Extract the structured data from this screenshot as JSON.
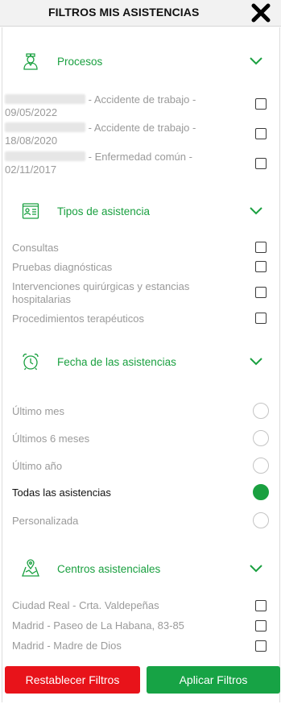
{
  "header": {
    "title": "FILTROS MIS ASISTENCIAS",
    "close_icon": "close-icon"
  },
  "sections": {
    "procesos": {
      "title": "Procesos",
      "icon": "nurse-icon",
      "items": [
        {
          "text": "- Accidente de trabajo -",
          "date": "09/05/2022",
          "checked": false
        },
        {
          "text": "- Accidente de trabajo -",
          "date": "18/08/2020",
          "checked": false
        },
        {
          "text": "- Enfermedad común -",
          "date": "02/11/2017",
          "checked": false
        }
      ]
    },
    "tipos": {
      "title": "Tipos de asistencia",
      "icon": "id-card-icon",
      "items": [
        {
          "label": "Consultas",
          "checked": false
        },
        {
          "label": "Pruebas diagnósticas",
          "checked": false
        },
        {
          "label": "Intervenciones quirúrgicas y estancias",
          "label2": "hospitalarias",
          "checked": false
        },
        {
          "label": "Procedimientos terapéuticos",
          "checked": false
        }
      ]
    },
    "fecha": {
      "title": "Fecha de las asistencias",
      "icon": "alarm-clock-icon",
      "options": [
        {
          "label": "Último mes",
          "selected": false
        },
        {
          "label": "Últimos 6 meses",
          "selected": false
        },
        {
          "label": "Último año",
          "selected": false
        },
        {
          "label": "Todas las asistencias",
          "selected": true
        },
        {
          "label": "Personalizada",
          "selected": false
        }
      ]
    },
    "centros": {
      "title": "Centros asistenciales",
      "icon": "map-pin-icon",
      "items": [
        {
          "label": "Ciudad Real - Crta. Valdepeñas",
          "checked": false
        },
        {
          "label": "Madrid - Paseo de La Habana, 83-85",
          "checked": false
        },
        {
          "label": "Madrid - Madre de Dios",
          "checked": false
        }
      ]
    }
  },
  "buttons": {
    "reset": "Restablecer Filtros",
    "apply": "Aplicar Filtros"
  },
  "colors": {
    "accent_green": "#1aa040",
    "reset_red": "#e8131a",
    "apply_green": "#17a345"
  }
}
